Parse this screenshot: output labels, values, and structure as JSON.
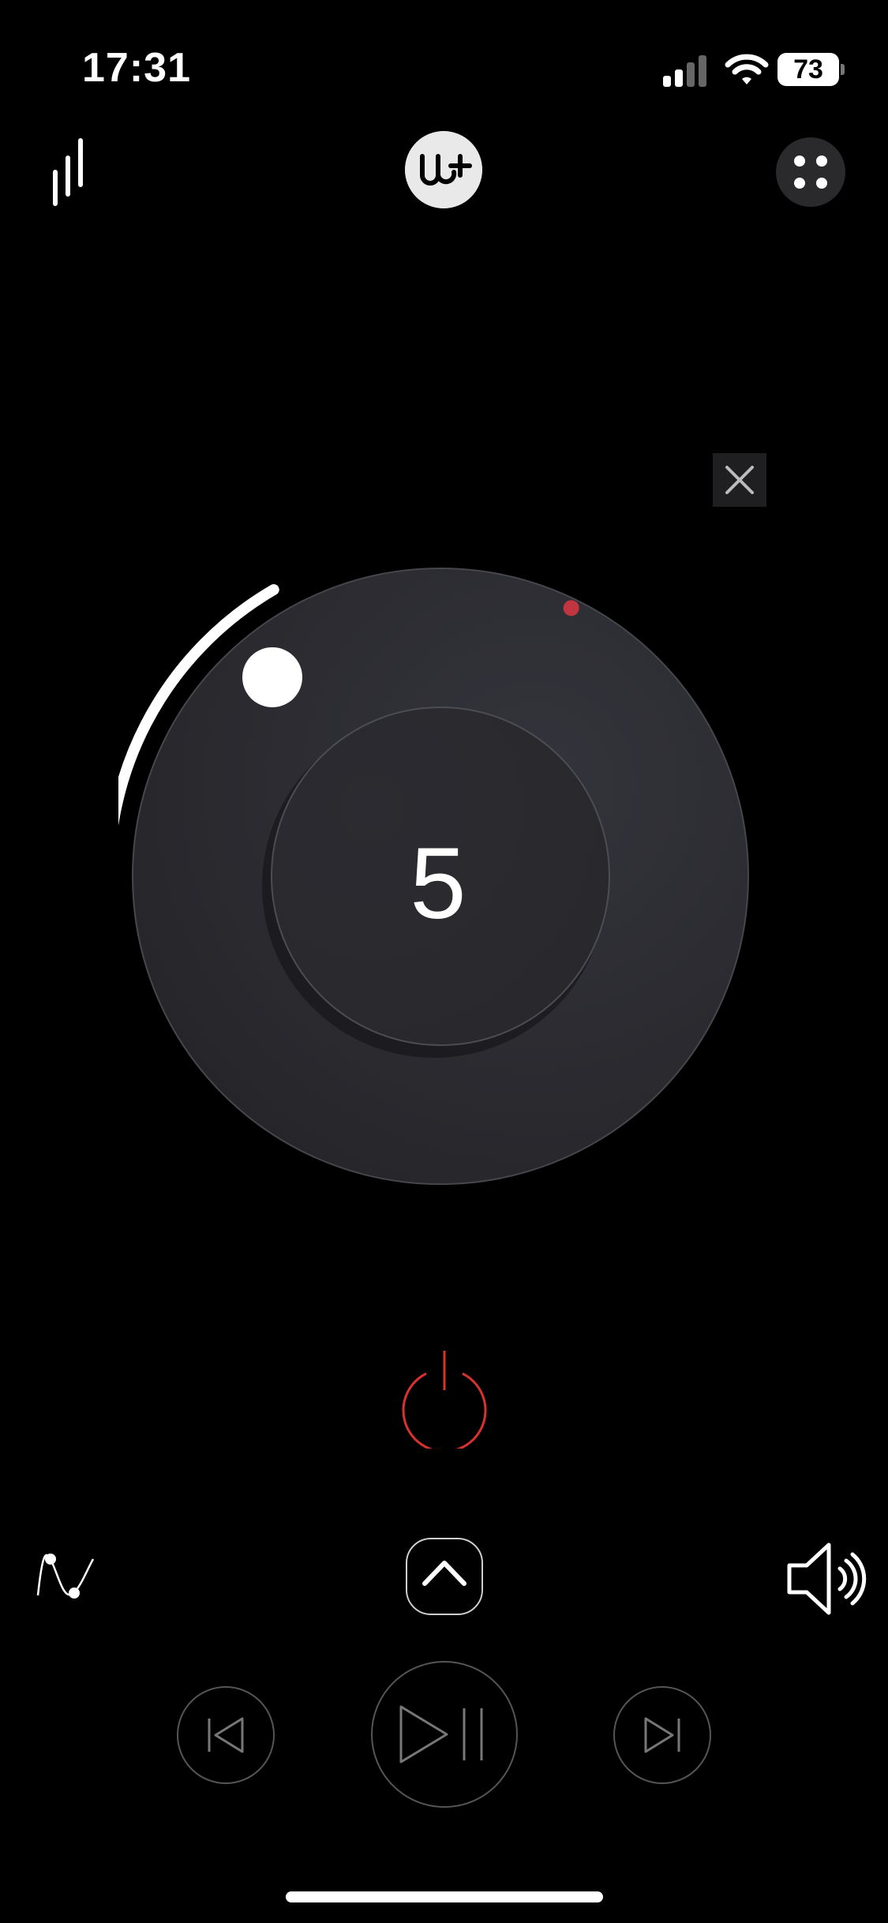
{
  "status_bar": {
    "time": "17:31",
    "battery_level": "73",
    "icons": [
      "cellular-signal-icon",
      "wifi-icon",
      "battery-icon"
    ]
  },
  "header": {
    "left_icon": "equalizer-bars-icon",
    "logo_text": "Ub+",
    "right_icon": "four-dots-grid-icon"
  },
  "dial": {
    "value": "5",
    "level_fraction": 0.18,
    "arc_color": "#ffffff",
    "marker_color": "#c0353f"
  },
  "controls": {
    "close_icon": "close-icon",
    "power_icon": "power-icon",
    "power_color": "#d8322f",
    "wave_icon": "sine-wave-icon",
    "collapse_icon": "chevron-up-icon",
    "speaker_icon": "speaker-volume-icon",
    "prev_icon": "skip-previous-icon",
    "play_pause_icon": "play-pause-icon",
    "next_icon": "skip-next-icon"
  }
}
